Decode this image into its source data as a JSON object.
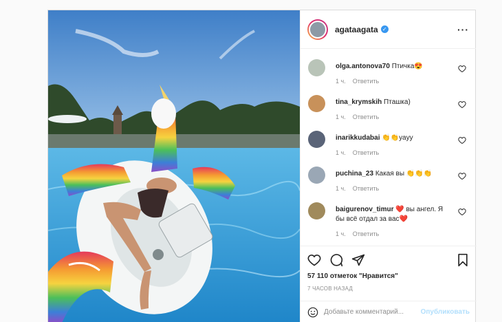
{
  "post": {
    "username": "agataagata",
    "verified_badge": "✓",
    "more_icon": "···",
    "photo_description_icon": "pool-unicorn-photo"
  },
  "comments": [
    {
      "user": "olga.antonova70",
      "text": "Птичка😍",
      "time": "1 ч.",
      "reply": "Ответить",
      "avatar_color": "#b9c4b8"
    },
    {
      "user": "tina_krymskih",
      "text": "Пташка)",
      "time": "1 ч.",
      "reply": "Ответить",
      "avatar_color": "#c8915a"
    },
    {
      "user": "inarikkudabai",
      "text": "👏👏уаyy",
      "time": "1 ч.",
      "reply": "Ответить",
      "avatar_color": "#5a6478"
    },
    {
      "user": "puchina_23",
      "text": "Какая вы 👏👏👏",
      "time": "1 ч.",
      "reply": "Ответить",
      "avatar_color": "#9aa7b5"
    },
    {
      "user": "baigurenov_timur",
      "text": "❤️ вы ангел. Я бы всё отдал за вас❤️",
      "time": "1 ч.",
      "reply": "Ответить",
      "avatar_color": "#a08a5c"
    }
  ],
  "likes": "57 110 отметок \"Нравится\"",
  "posted_time": "7 ЧАСОВ НАЗАД",
  "add_comment": {
    "placeholder": "Добавьте комментарий...",
    "publish_label": "Опубликовать"
  },
  "colors": {
    "accent": "#3897f0",
    "publish_disabled": "#b2dffc",
    "pool": "#3e9ed8",
    "sky": "#5a9bd8"
  }
}
